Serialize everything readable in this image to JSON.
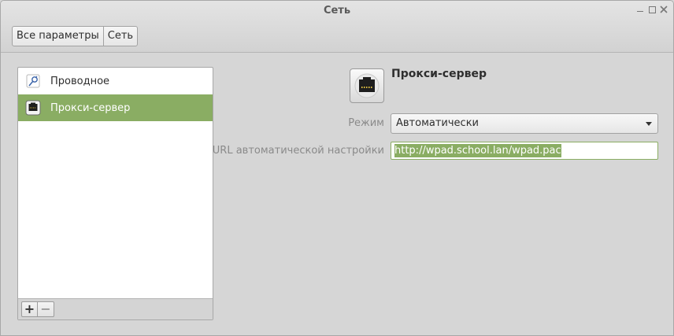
{
  "window": {
    "title": "Сеть"
  },
  "breadcrumb": {
    "items": [
      "Все параметры",
      "Сеть"
    ]
  },
  "sidebar": {
    "items": [
      {
        "label": "Проводное",
        "icon": "wired-network-icon",
        "selected": false
      },
      {
        "label": "Прокси-сервер",
        "icon": "proxy-server-icon",
        "selected": true
      }
    ],
    "add_label": "+",
    "remove_label": "−"
  },
  "panel": {
    "title": "Прокси-сервер",
    "icon": "proxy-server-icon",
    "mode_label": "Режим",
    "mode_value": "Автоматически",
    "url_label": "URL автоматической настройки",
    "url_value": "http://wpad.school.lan/wpad.pac"
  },
  "colors": {
    "accent": "#8aad63"
  }
}
